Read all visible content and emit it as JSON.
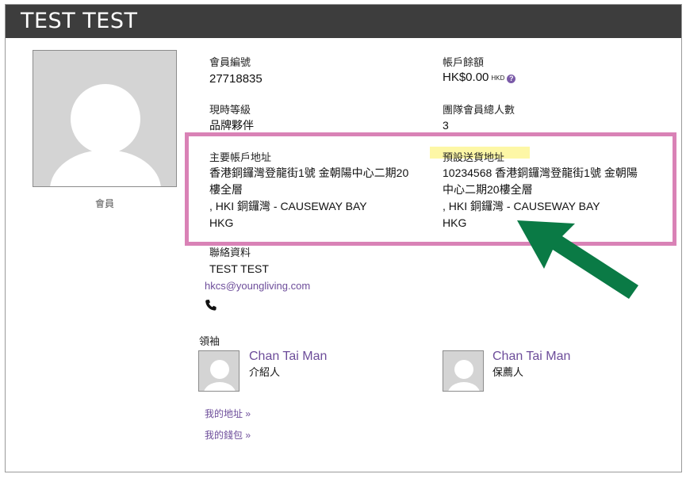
{
  "header": {
    "title": "TEST TEST"
  },
  "profile": {
    "caption": "會員"
  },
  "member_number": {
    "label": "會員編號",
    "value": "27718835"
  },
  "balance": {
    "label": "帳戶餘額",
    "value": "HK$0.00",
    "unit": "HKD",
    "help": "?"
  },
  "rank": {
    "label": "現時等級",
    "value": "品牌夥伴"
  },
  "team": {
    "label": "團隊會員總人數",
    "value": "3"
  },
  "primary_address": {
    "label": "主要帳戶地址",
    "line1": "香港銅鑼灣登龍街1號 金朝陽中心二期20",
    "line2": "樓全層",
    "line3": ", HKI 銅鑼灣 - CAUSEWAY BAY",
    "line4": "HKG"
  },
  "shipping_address": {
    "label": "預設送貨地址",
    "line1": "10234568 香港銅鑼灣登龍街1號 金朝陽",
    "line2": "中心二期20樓全層",
    "line3": ", HKI 銅鑼灣 - CAUSEWAY BAY",
    "line4": "HKG"
  },
  "contact": {
    "label": "聯絡資料",
    "name": "TEST TEST",
    "email": "hkcs@youngliving.com"
  },
  "leaders": {
    "label": "領袖",
    "enroller": {
      "name": "Chan Tai Man",
      "role": "介紹人"
    },
    "sponsor": {
      "name": "Chan Tai Man",
      "role": "保薦人"
    }
  },
  "links": {
    "my_address": "我的地址 »",
    "my_wallet": "我的錢包 »"
  },
  "colors": {
    "header_bg": "#3d3d3d",
    "link": "#6d4d9a",
    "highlight_border": "#d982b6",
    "arrow": "#0a7a45",
    "marker": "#fdf7a6"
  }
}
